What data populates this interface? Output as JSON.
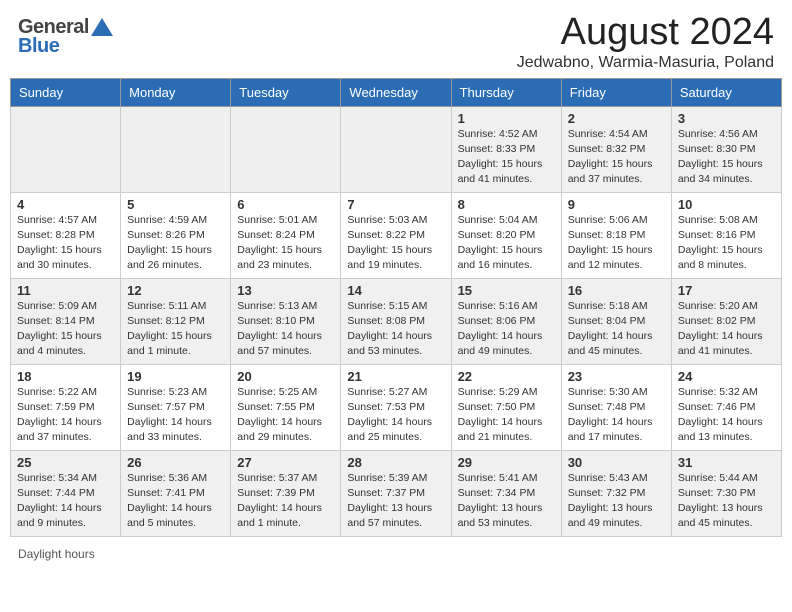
{
  "header": {
    "logo_general": "General",
    "logo_blue": "Blue",
    "title": "August 2024",
    "subtitle": "Jedwabno, Warmia-Masuria, Poland"
  },
  "days_of_week": [
    "Sunday",
    "Monday",
    "Tuesday",
    "Wednesday",
    "Thursday",
    "Friday",
    "Saturday"
  ],
  "weeks": [
    {
      "days": [
        {
          "num": "",
          "info": "",
          "empty": true
        },
        {
          "num": "",
          "info": "",
          "empty": true
        },
        {
          "num": "",
          "info": "",
          "empty": true
        },
        {
          "num": "",
          "info": "",
          "empty": true
        },
        {
          "num": "1",
          "info": "Sunrise: 4:52 AM\nSunset: 8:33 PM\nDaylight: 15 hours\nand 41 minutes."
        },
        {
          "num": "2",
          "info": "Sunrise: 4:54 AM\nSunset: 8:32 PM\nDaylight: 15 hours\nand 37 minutes."
        },
        {
          "num": "3",
          "info": "Sunrise: 4:56 AM\nSunset: 8:30 PM\nDaylight: 15 hours\nand 34 minutes."
        }
      ]
    },
    {
      "days": [
        {
          "num": "4",
          "info": "Sunrise: 4:57 AM\nSunset: 8:28 PM\nDaylight: 15 hours\nand 30 minutes."
        },
        {
          "num": "5",
          "info": "Sunrise: 4:59 AM\nSunset: 8:26 PM\nDaylight: 15 hours\nand 26 minutes."
        },
        {
          "num": "6",
          "info": "Sunrise: 5:01 AM\nSunset: 8:24 PM\nDaylight: 15 hours\nand 23 minutes."
        },
        {
          "num": "7",
          "info": "Sunrise: 5:03 AM\nSunset: 8:22 PM\nDaylight: 15 hours\nand 19 minutes."
        },
        {
          "num": "8",
          "info": "Sunrise: 5:04 AM\nSunset: 8:20 PM\nDaylight: 15 hours\nand 16 minutes."
        },
        {
          "num": "9",
          "info": "Sunrise: 5:06 AM\nSunset: 8:18 PM\nDaylight: 15 hours\nand 12 minutes."
        },
        {
          "num": "10",
          "info": "Sunrise: 5:08 AM\nSunset: 8:16 PM\nDaylight: 15 hours\nand 8 minutes."
        }
      ]
    },
    {
      "days": [
        {
          "num": "11",
          "info": "Sunrise: 5:09 AM\nSunset: 8:14 PM\nDaylight: 15 hours\nand 4 minutes."
        },
        {
          "num": "12",
          "info": "Sunrise: 5:11 AM\nSunset: 8:12 PM\nDaylight: 15 hours\nand 1 minute."
        },
        {
          "num": "13",
          "info": "Sunrise: 5:13 AM\nSunset: 8:10 PM\nDaylight: 14 hours\nand 57 minutes."
        },
        {
          "num": "14",
          "info": "Sunrise: 5:15 AM\nSunset: 8:08 PM\nDaylight: 14 hours\nand 53 minutes."
        },
        {
          "num": "15",
          "info": "Sunrise: 5:16 AM\nSunset: 8:06 PM\nDaylight: 14 hours\nand 49 minutes."
        },
        {
          "num": "16",
          "info": "Sunrise: 5:18 AM\nSunset: 8:04 PM\nDaylight: 14 hours\nand 45 minutes."
        },
        {
          "num": "17",
          "info": "Sunrise: 5:20 AM\nSunset: 8:02 PM\nDaylight: 14 hours\nand 41 minutes."
        }
      ]
    },
    {
      "days": [
        {
          "num": "18",
          "info": "Sunrise: 5:22 AM\nSunset: 7:59 PM\nDaylight: 14 hours\nand 37 minutes."
        },
        {
          "num": "19",
          "info": "Sunrise: 5:23 AM\nSunset: 7:57 PM\nDaylight: 14 hours\nand 33 minutes."
        },
        {
          "num": "20",
          "info": "Sunrise: 5:25 AM\nSunset: 7:55 PM\nDaylight: 14 hours\nand 29 minutes."
        },
        {
          "num": "21",
          "info": "Sunrise: 5:27 AM\nSunset: 7:53 PM\nDaylight: 14 hours\nand 25 minutes."
        },
        {
          "num": "22",
          "info": "Sunrise: 5:29 AM\nSunset: 7:50 PM\nDaylight: 14 hours\nand 21 minutes."
        },
        {
          "num": "23",
          "info": "Sunrise: 5:30 AM\nSunset: 7:48 PM\nDaylight: 14 hours\nand 17 minutes."
        },
        {
          "num": "24",
          "info": "Sunrise: 5:32 AM\nSunset: 7:46 PM\nDaylight: 14 hours\nand 13 minutes."
        }
      ]
    },
    {
      "days": [
        {
          "num": "25",
          "info": "Sunrise: 5:34 AM\nSunset: 7:44 PM\nDaylight: 14 hours\nand 9 minutes."
        },
        {
          "num": "26",
          "info": "Sunrise: 5:36 AM\nSunset: 7:41 PM\nDaylight: 14 hours\nand 5 minutes."
        },
        {
          "num": "27",
          "info": "Sunrise: 5:37 AM\nSunset: 7:39 PM\nDaylight: 14 hours\nand 1 minute."
        },
        {
          "num": "28",
          "info": "Sunrise: 5:39 AM\nSunset: 7:37 PM\nDaylight: 13 hours\nand 57 minutes."
        },
        {
          "num": "29",
          "info": "Sunrise: 5:41 AM\nSunset: 7:34 PM\nDaylight: 13 hours\nand 53 minutes."
        },
        {
          "num": "30",
          "info": "Sunrise: 5:43 AM\nSunset: 7:32 PM\nDaylight: 13 hours\nand 49 minutes."
        },
        {
          "num": "31",
          "info": "Sunrise: 5:44 AM\nSunset: 7:30 PM\nDaylight: 13 hours\nand 45 minutes."
        }
      ]
    }
  ],
  "footer": {
    "daylight_label": "Daylight hours"
  }
}
